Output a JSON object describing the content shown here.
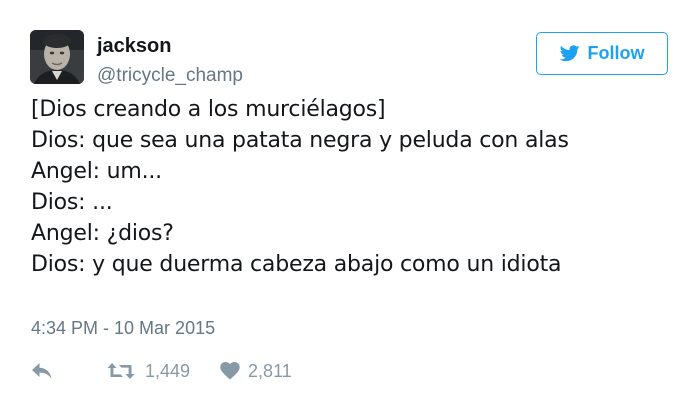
{
  "user": {
    "display_name": "jackson",
    "handle": "@tricycle_champ"
  },
  "follow_button": {
    "label": "Follow",
    "icon": "twitter-bird-icon",
    "color": "#1da1f2"
  },
  "tweet": {
    "lines": [
      "[Dios creando a los murciélagos]",
      "Dios: que sea una patata negra y peluda con alas",
      "Angel: um...",
      "Dios: ...",
      "Angel: ¿dios?",
      "Dios: y que duerma cabeza abajo como un idiota"
    ],
    "timestamp": "4:34 PM - 10 Mar 2015"
  },
  "actions": {
    "reply": {
      "icon": "reply-icon"
    },
    "retweet": {
      "icon": "retweet-icon",
      "count": "1,449"
    },
    "like": {
      "icon": "heart-icon",
      "count": "2,811"
    }
  }
}
